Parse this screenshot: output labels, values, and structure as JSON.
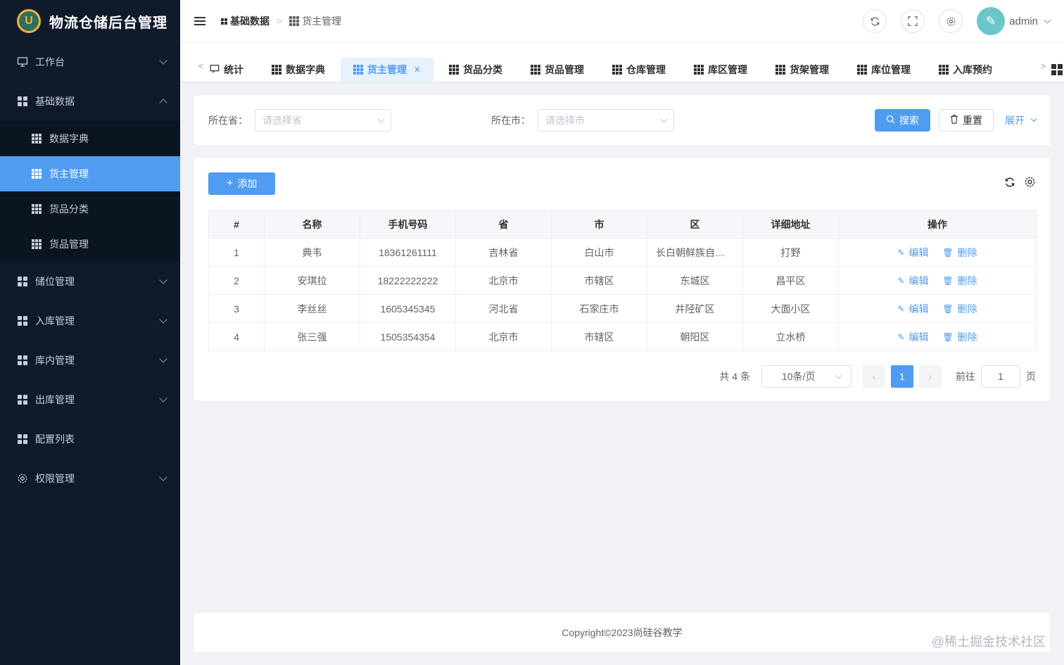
{
  "brand": {
    "logo_letter": "U",
    "title": "物流仓储后台管理"
  },
  "sidebar": {
    "items": [
      {
        "label": "工作台",
        "icon": "monitor-icon",
        "expanded": false
      },
      {
        "label": "基础数据",
        "icon": "grid-icon",
        "expanded": true,
        "children": [
          {
            "label": "数据字典",
            "active": false
          },
          {
            "label": "货主管理",
            "active": true
          },
          {
            "label": "货品分类",
            "active": false
          },
          {
            "label": "货品管理",
            "active": false
          }
        ]
      },
      {
        "label": "储位管理",
        "icon": "grid-icon",
        "expanded": false
      },
      {
        "label": "入库管理",
        "icon": "grid-icon",
        "expanded": false
      },
      {
        "label": "库内管理",
        "icon": "grid-icon",
        "expanded": false
      },
      {
        "label": "出库管理",
        "icon": "grid-icon",
        "expanded": false
      },
      {
        "label": "配置列表",
        "icon": "grid-icon"
      },
      {
        "label": "权限管理",
        "icon": "gear-icon",
        "expanded": false
      }
    ]
  },
  "header": {
    "breadcrumb": [
      "基础数据",
      "货主管理"
    ],
    "user": "admin"
  },
  "tabs": [
    {
      "label": "统计",
      "icon": "chat-icon"
    },
    {
      "label": "数据字典"
    },
    {
      "label": "货主管理",
      "active": true
    },
    {
      "label": "货品分类"
    },
    {
      "label": "货品管理"
    },
    {
      "label": "仓库管理"
    },
    {
      "label": "库区管理"
    },
    {
      "label": "货架管理"
    },
    {
      "label": "库位管理"
    },
    {
      "label": "入库预约"
    }
  ],
  "search": {
    "province_label": "所在省：",
    "province_placeholder": "请选择省",
    "city_label": "所在市：",
    "city_placeholder": "请选择市",
    "search_btn": "搜索",
    "reset_btn": "重置",
    "expand_btn": "展开"
  },
  "table": {
    "add_btn": "添加",
    "columns": [
      "#",
      "名称",
      "手机号码",
      "省",
      "市",
      "区",
      "详细地址",
      "操作"
    ],
    "rows": [
      [
        "1",
        "典韦",
        "18361261111",
        "吉林省",
        "白山市",
        "长白朝鲜族自治县",
        "打野"
      ],
      [
        "2",
        "安琪拉",
        "18222222222",
        "北京市",
        "市辖区",
        "东城区",
        "昌平区"
      ],
      [
        "3",
        "李丝丝",
        "1605345345",
        "河北省",
        "石家庄市",
        "井陉矿区",
        "大面小区"
      ],
      [
        "4",
        "张三强",
        "1505354354",
        "北京市",
        "市辖区",
        "朝阳区",
        "立水桥"
      ]
    ],
    "edit_label": "编辑",
    "delete_label": "删除"
  },
  "pagination": {
    "total_text": "共 4 条",
    "page_size": "10条/页",
    "current_page": "1",
    "goto_label": "前往",
    "goto_value": "1",
    "page_suffix": "页"
  },
  "footer": {
    "copyright": "Copyright©2023尚硅谷教学"
  },
  "watermark": "@稀土掘金技术社区",
  "colors": {
    "sidebar_bg": "#0f1a2b",
    "accent": "#4f9cf0"
  }
}
